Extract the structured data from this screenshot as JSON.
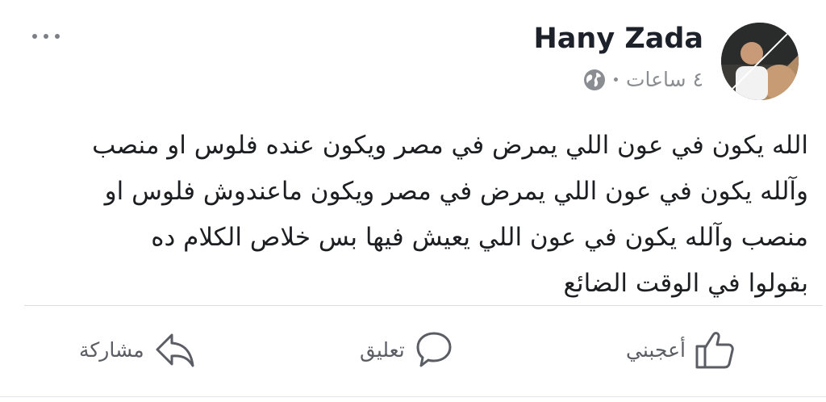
{
  "post": {
    "author": "Hany Zada",
    "time": "٤ ساعات",
    "privacy_icon": "globe-icon",
    "lines": [
      "الله يكون في عون اللي يمرض في مصر ويكون عنده فلوس او منصب",
      "وآلله يكون في عون اللي يمرض في مصر ويكون ماعندوش فلوس او",
      "منصب وآلله يكون في عون اللي يعيش فيها بس خلاص الكلام ده",
      "بقولوا في الوقت الضائع"
    ]
  },
  "actions": {
    "like": "أعجبني",
    "comment": "تعليق",
    "share": "مشاركة"
  },
  "colors": {
    "text": "#1c1e21",
    "secondary": "#8a8d91",
    "divider": "#dadde1"
  }
}
